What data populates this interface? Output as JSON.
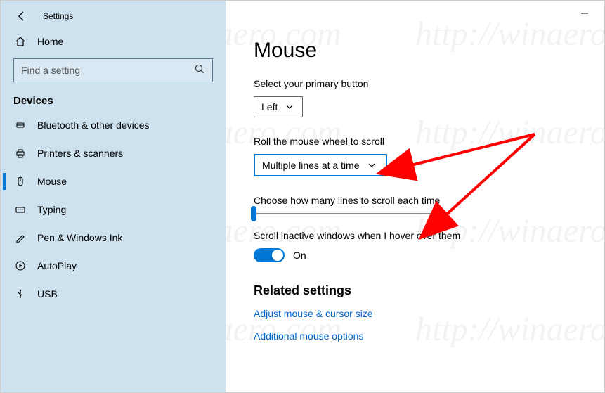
{
  "window": {
    "title": "Settings",
    "home_label": "Home",
    "search_placeholder": "Find a setting",
    "section_header": "Devices"
  },
  "nav": {
    "items": [
      {
        "label": "Bluetooth & other devices"
      },
      {
        "label": "Printers & scanners"
      },
      {
        "label": "Mouse"
      },
      {
        "label": "Typing"
      },
      {
        "label": "Pen & Windows Ink"
      },
      {
        "label": "AutoPlay"
      },
      {
        "label": "USB"
      }
    ]
  },
  "page": {
    "title": "Mouse",
    "primary_button_label": "Select your primary button",
    "primary_button_value": "Left",
    "scroll_mode_label": "Roll the mouse wheel to scroll",
    "scroll_mode_value": "Multiple lines at a time",
    "lines_label": "Choose how many lines to scroll each time",
    "inactive_label": "Scroll inactive windows when I hover over them",
    "toggle_state": "On",
    "related_header": "Related settings",
    "link1": "Adjust mouse & cursor size",
    "link2": "Additional mouse options"
  },
  "watermark": "http://winaero.com"
}
